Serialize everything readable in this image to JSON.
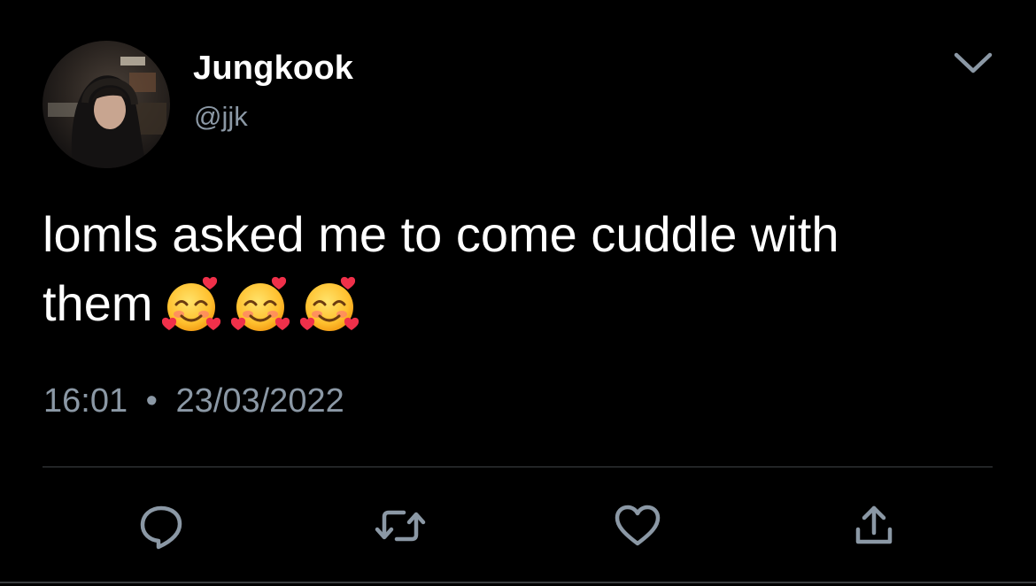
{
  "tweet": {
    "author": {
      "display_name": "Jungkook",
      "handle": "@jjk",
      "avatar_icon": "profile-photo"
    },
    "text_line1": "lomls asked me to come cuddle with",
    "text_line2": "them",
    "emojis": [
      "smiling-face-with-hearts",
      "smiling-face-with-hearts",
      "smiling-face-with-hearts"
    ],
    "time": "16:01",
    "separator": "•",
    "date": "23/03/2022",
    "menu_icon": "chevron-down-icon",
    "actions": [
      {
        "name": "reply",
        "icon": "reply-icon"
      },
      {
        "name": "retweet",
        "icon": "retweet-icon"
      },
      {
        "name": "like",
        "icon": "heart-icon"
      },
      {
        "name": "share",
        "icon": "share-icon"
      }
    ]
  },
  "colors": {
    "background": "#000000",
    "text": "#ffffff",
    "secondary": "#8b98a5",
    "icon": "#8b98a5",
    "divider": "#3e4144"
  }
}
